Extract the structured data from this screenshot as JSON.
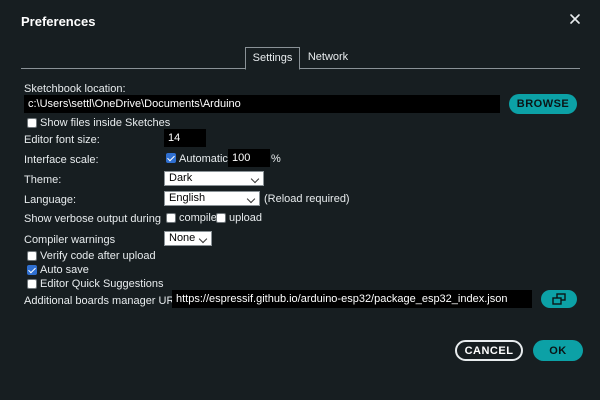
{
  "dialog": {
    "title": "Preferences"
  },
  "tabs": [
    {
      "label": "Settings",
      "active": true
    },
    {
      "label": "Network",
      "active": false
    }
  ],
  "sketchbook": {
    "label": "Sketchbook location:",
    "value": "c:\\Users\\settl\\OneDrive\\Documents\\Arduino",
    "browse_label": "BROWSE",
    "show_files_label": "Show files inside Sketches",
    "show_files_checked": false
  },
  "font_size": {
    "label": "Editor font size:",
    "value": "14"
  },
  "scale": {
    "label": "Interface scale:",
    "automatic_label": "Automatic",
    "automatic_checked": true,
    "value": "100",
    "unit": "%"
  },
  "theme": {
    "label": "Theme:",
    "value": "Dark"
  },
  "language": {
    "label": "Language:",
    "value": "English",
    "note": "(Reload required)"
  },
  "verbose": {
    "label": "Show verbose output during",
    "compile_label": "compile",
    "compile_checked": false,
    "upload_label": "upload",
    "upload_checked": false
  },
  "warnings": {
    "label": "Compiler warnings",
    "value": "None"
  },
  "options": [
    {
      "label": "Verify code after upload",
      "checked": false
    },
    {
      "label": "Auto save",
      "checked": true
    },
    {
      "label": "Editor Quick Suggestions",
      "checked": false
    }
  ],
  "boards": {
    "label": "Additional boards manager URLs:",
    "value": "https://espressif.github.io/arduino-esp32/package_esp32_index.json",
    "icon": "open-window-icon"
  },
  "footer": {
    "cancel_label": "CANCEL",
    "ok_label": "OK"
  },
  "colors": {
    "background": "#171e21",
    "accent": "#0ca1a6",
    "field": "#000000",
    "checkbox_on": "#2f6fd0"
  }
}
